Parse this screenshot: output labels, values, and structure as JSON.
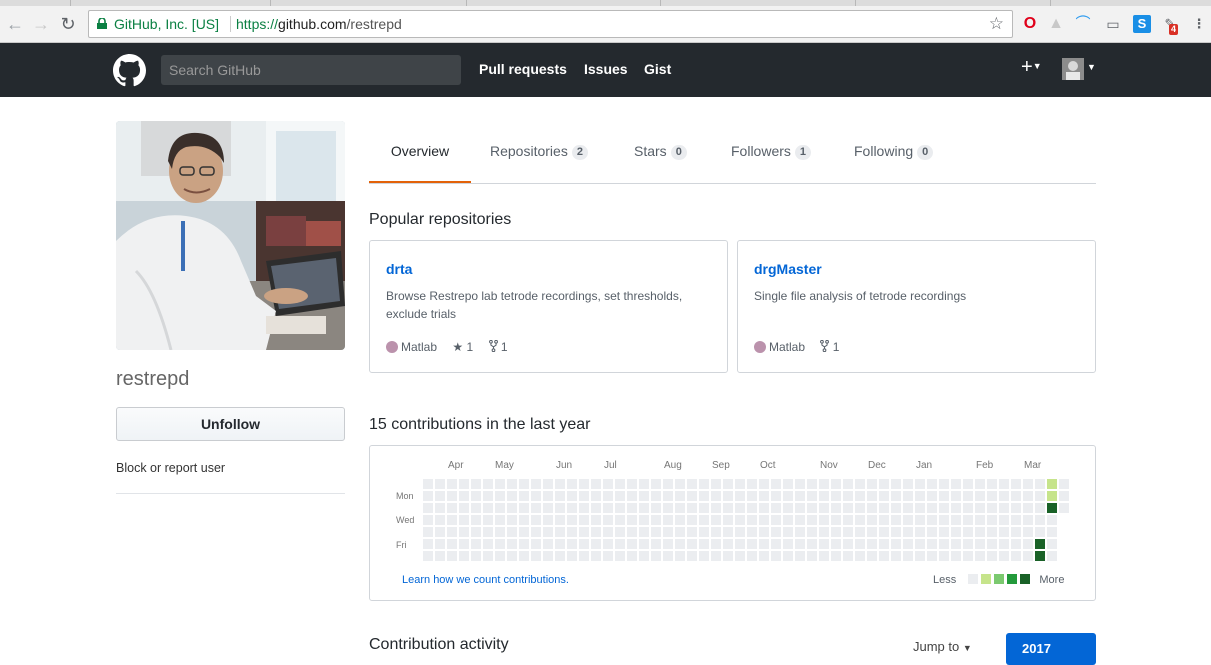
{
  "browser": {
    "site_identity": "GitHub, Inc. [US]",
    "url_scheme": "https://",
    "url_host": "github.com",
    "url_path": "/restrepd",
    "notification_count": "4"
  },
  "header": {
    "search_placeholder": "Search GitHub",
    "nav": [
      "Pull requests",
      "Issues",
      "Gist"
    ],
    "plus_label": "+"
  },
  "profile": {
    "username": "restrepd",
    "unfollow_label": "Unfollow",
    "block_label": "Block or report user"
  },
  "tabs": [
    {
      "label": "Overview",
      "count": ""
    },
    {
      "label": "Repositories",
      "count": "2"
    },
    {
      "label": "Stars",
      "count": "0"
    },
    {
      "label": "Followers",
      "count": "1"
    },
    {
      "label": "Following",
      "count": "0"
    }
  ],
  "popular": {
    "title": "Popular repositories",
    "repos": [
      {
        "name": "drta",
        "description": "Browse Restrepo lab tetrode recordings, set thresholds, exclude trials",
        "language": "Matlab",
        "stars": "1",
        "forks": "1"
      },
      {
        "name": "drgMaster",
        "description": "Single file analysis of tetrode recordings",
        "language": "Matlab",
        "stars": "",
        "forks": "1"
      }
    ]
  },
  "contributions": {
    "title": "15 contributions in the last year",
    "months": [
      "Apr",
      "May",
      "Jun",
      "Jul",
      "Aug",
      "Sep",
      "Oct",
      "Nov",
      "Dec",
      "Jan",
      "Feb",
      "Mar"
    ],
    "weekdays": [
      "Mon",
      "Wed",
      "Fri"
    ],
    "learn_link": "Learn how we count contributions.",
    "legend_less": "Less",
    "legend_more": "More",
    "colors": [
      "#ebedf0",
      "#c6e48b",
      "#7bc96f",
      "#239a3b",
      "#196127"
    ]
  },
  "activity": {
    "title": "Contribution activity",
    "jump_label": "Jump to",
    "year": "2017"
  }
}
